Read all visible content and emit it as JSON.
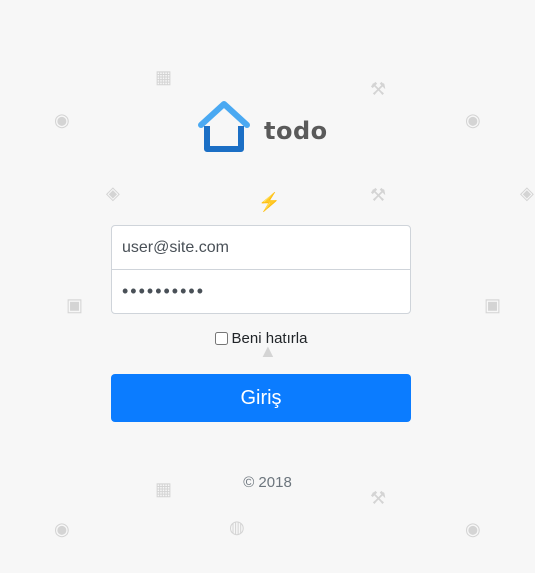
{
  "brand": {
    "name": "todo",
    "icon": "house-icon",
    "colors": {
      "accent": "#4aa9f2",
      "accent_dark": "#1b6fc5",
      "text": "#5a5a5a"
    }
  },
  "login": {
    "email_value": "user@site.com",
    "password_value": "••••••••••",
    "remember_label": "Beni hatırla",
    "remember_checked": false,
    "submit_label": "Giriş",
    "button_color": "#0b7cff"
  },
  "footer": {
    "copyright": "© 2018"
  },
  "background_icons": [
    "flash-icon",
    "eye-icon",
    "tool-icon",
    "grid-icon",
    "chip-icon",
    "camera-icon"
  ]
}
